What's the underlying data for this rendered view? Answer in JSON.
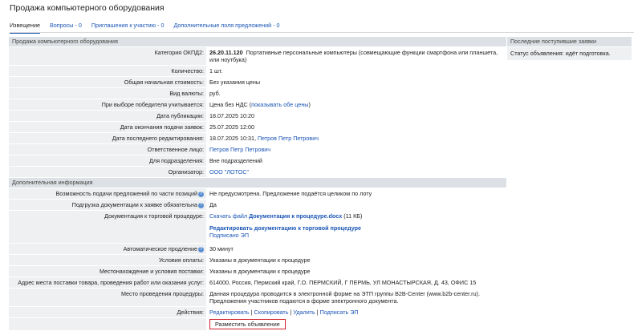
{
  "page_title": "Продажа компьютерного оборудования",
  "tabs": [
    "Извещение",
    "Вопросы - 0",
    "Приглашения к участию - 0",
    "Дополнительные поля предложений - 0"
  ],
  "section_main": "Продажа компьютерного оборудования",
  "okpd": {
    "label": "Категория ОКПД2:",
    "code": "26.20.11.120",
    "text": "Портативные персональные компьютеры (совмещающие функции смартфона или планшета, или ноутбука)"
  },
  "rows": [
    {
      "label": "Количество:",
      "value": "1 шт."
    },
    {
      "label": "Общая начальная стоимость:",
      "value": "Без указания цены"
    },
    {
      "label": "Вид валюты:",
      "value": "руб."
    }
  ],
  "winner": {
    "label": "При выборе победителя учитывается:",
    "value": "Цена без НДС (",
    "link": "показывать обе цены",
    "after": ")"
  },
  "pub": {
    "label": "Дата публикации:",
    "value": "18.07.2025 10:20"
  },
  "end": {
    "label": "Дата окончания подачи заявок:",
    "value": "25.07.2025 12:00"
  },
  "edit": {
    "label": "Дата последнего редактирования:",
    "value": "18.07.2025 10:31,",
    "link": "Петров Петр Петрович"
  },
  "resp": {
    "label": "Ответственное лицо:",
    "link": "Петров Петр Петрович"
  },
  "dept": {
    "label": "Для подразделения:",
    "value": "Вне подразделений"
  },
  "org": {
    "label": "Организатор:",
    "link": "ООО \"ЛОТОС\""
  },
  "section_extra": "Дополнительная информация",
  "parts": {
    "label": "Возможность подачи предложений по части позиций",
    "value": "Не предусмотрена. Предложение подаётся целиком по лоту"
  },
  "docs_req": {
    "label": "Подгрузка документации к заявке обязательна",
    "value": "Да"
  },
  "docs": {
    "label": "Документация к торговой процедуре:",
    "download": "Скачать файл",
    "file": "Документация к процедуре.docx",
    "size": "(11 КБ)",
    "edit_link": "Редактировать документацию к торговой процедуре",
    "signed": "Подписано ЭП"
  },
  "auto": {
    "label": "Автоматическое продление",
    "value": "30 минут"
  },
  "pay": {
    "label": "Условия оплаты:",
    "value": "Указаны в документации к процедуре"
  },
  "place": {
    "label": "Местонахождение и условия поставки:",
    "value": "Указаны в документации к процедуре"
  },
  "address": {
    "label": "Адрес места поставки товара, проведения работ или оказания услуг:",
    "value": "614000, Россия, Пермский край, Г.О. ПЕРМСКИЙ, Г ПЕРМЬ, УЛ МОНАСТЫРСКАЯ, Д. 43, ОФИС 15"
  },
  "venue": {
    "label": "Место проведения процедуры:",
    "line1": "Данная процедура проводится в электронной форме на ЭТП группы B2B-Center (www.b2b-center.ru).",
    "line2": "Предложения участников подаются в форме электронного документа."
  },
  "actions": {
    "label": "Действия:",
    "edit": "Редактировать",
    "copy": "Скопировать",
    "delete": "Удалить",
    "sign": "Подписать ЭП",
    "sep": "|"
  },
  "publish_button": "Разместить объявление",
  "side": {
    "title": "Последние поступившие заявки",
    "status": "Статус объявления: идёт подготовка."
  },
  "colors": {
    "link": "#1a55b5",
    "section_bg": "#dde1e6",
    "row_bg": "#eef0f2",
    "button_border": "#d0202a"
  }
}
